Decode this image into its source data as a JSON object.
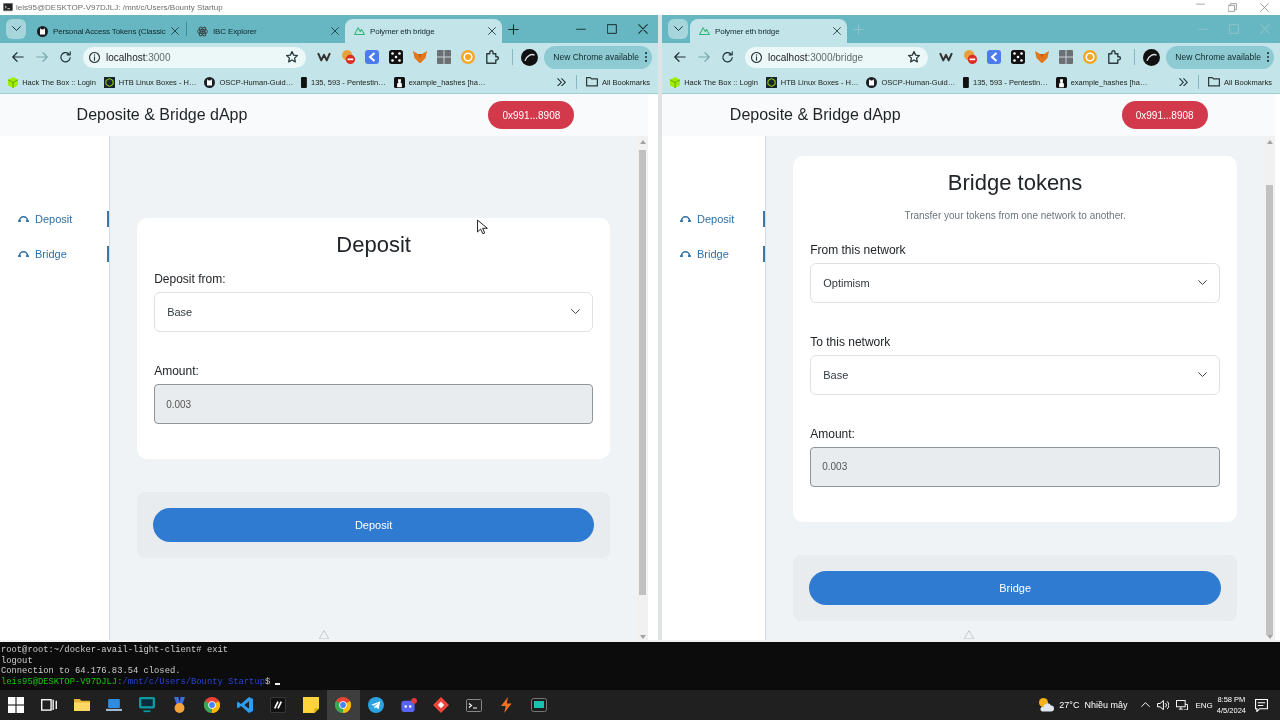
{
  "terminal_window": {
    "title": "leis95@DESKTOP-V97DJLJ: /mnt/c/Users/Bounty Startup"
  },
  "browsers": [
    {
      "focused": true,
      "tabs": [
        {
          "kind": "cat",
          "title": "Personal Access Tokens (Classic",
          "selected": false
        },
        {
          "kind": "atom",
          "title": "IBC Explorer",
          "selected": false
        },
        {
          "kind": "mountain",
          "title": "Polymer eth bridge",
          "selected": true
        }
      ],
      "address": {
        "host": "localhost",
        "path": ":3000"
      },
      "extensions": [
        {
          "kind": "zigzag"
        },
        {
          "kind": "no-entry"
        },
        {
          "kind": "chevron-tile"
        },
        {
          "kind": "dice"
        },
        {
          "kind": "fox"
        },
        {
          "kind": "grid"
        },
        {
          "kind": "coin"
        },
        {
          "kind": "puzzle"
        }
      ],
      "update_button": "New Chrome available",
      "bookmarks": [
        {
          "kind": "cube",
          "label": "Hack The Box :: Login"
        },
        {
          "kind": "box",
          "label": "HTB Linux Boxes - H…"
        },
        {
          "kind": "cat",
          "label": "OSCP-Human-Guid…"
        },
        {
          "kind": "phone",
          "label": "135, 593 - Pentestin…"
        },
        {
          "kind": "figure",
          "label": "example_hashes [ha…"
        }
      ],
      "all_bookmarks": "All Bookmarks",
      "page": {
        "app_title": "Deposite & Bridge dApp",
        "wallet_button": "0x991...8908",
        "nav": [
          {
            "label": "Deposit"
          },
          {
            "label": "Bridge"
          }
        ],
        "card": {
          "title": "Deposit",
          "fields": [
            {
              "kind": "select",
              "label": "Deposit from:",
              "value": "Base"
            },
            {
              "kind": "input",
              "label": "Amount:",
              "value": "0.003"
            }
          ]
        },
        "action_button": "Deposit"
      }
    },
    {
      "focused": false,
      "tabs": [
        {
          "kind": "mountain",
          "title": "Polymer eth bridge",
          "selected": true
        }
      ],
      "address": {
        "host": "localhost",
        "path": ":3000/bridge"
      },
      "extensions": [
        {
          "kind": "zigzag"
        },
        {
          "kind": "no-entry"
        },
        {
          "kind": "chevron-tile"
        },
        {
          "kind": "dice"
        },
        {
          "kind": "fox"
        },
        {
          "kind": "grid"
        },
        {
          "kind": "coin"
        },
        {
          "kind": "puzzle"
        }
      ],
      "update_button": "New Chrome available",
      "bookmarks": [
        {
          "kind": "cube",
          "label": "Hack The Box :: Login"
        },
        {
          "kind": "box",
          "label": "HTB Linux Boxes - H…"
        },
        {
          "kind": "cat",
          "label": "OSCP-Human-Guid…"
        },
        {
          "kind": "phone",
          "label": "135, 593 - Pentestin…"
        },
        {
          "kind": "figure",
          "label": "example_hashes [ha…"
        }
      ],
      "all_bookmarks": "All Bookmarks",
      "page": {
        "app_title": "Deposite & Bridge dApp",
        "wallet_button": "0x991...8908",
        "nav": [
          {
            "label": "Deposit"
          },
          {
            "label": "Bridge"
          }
        ],
        "card": {
          "title": "Bridge tokens",
          "subtitle": "Transfer your tokens from one network to another.",
          "fields": [
            {
              "kind": "select",
              "label": "From this network",
              "value": "Optimism"
            },
            {
              "kind": "select",
              "label": "To this network",
              "value": "Base"
            },
            {
              "kind": "input",
              "label": "Amount:",
              "value": "0.003"
            }
          ]
        },
        "action_button": "Bridge"
      }
    }
  ],
  "terminal_output": {
    "lines": [
      {
        "kind": "text",
        "text": "root@root:~/docker-avail-light-client# exit"
      },
      {
        "kind": "text",
        "text": "logout"
      },
      {
        "kind": "text",
        "text": "Connection to 64.176.83.54 closed."
      },
      {
        "kind": "prompt",
        "user": "leis95@DESKTOP-V97DJLJ:",
        "path": "/mnt/c/Users/Bounty Startup",
        "symbol": "$"
      }
    ]
  },
  "taskbar": {
    "apps": [
      {
        "kind": "start",
        "active": false
      },
      {
        "kind": "task-view",
        "active": false
      },
      {
        "kind": "folder",
        "active": false
      },
      {
        "kind": "laptop",
        "active": false
      },
      {
        "kind": "monitor",
        "active": false
      },
      {
        "kind": "medal",
        "active": false
      },
      {
        "kind": "segmented-circle",
        "active": false
      },
      {
        "kind": "ribbon",
        "active": false
      },
      {
        "kind": "slashes",
        "active": false
      },
      {
        "kind": "sticky-note",
        "active": false
      },
      {
        "kind": "segmented-circle",
        "active": true
      },
      {
        "kind": "paper-plane",
        "active": false
      },
      {
        "kind": "controller",
        "active": false
      },
      {
        "kind": "diamond",
        "active": false
      },
      {
        "kind": "terminal",
        "active": false
      },
      {
        "kind": "bolt",
        "active": false
      },
      {
        "kind": "screen",
        "active": false
      }
    ],
    "weather": {
      "temperature": "27°C",
      "condition": "Nhiều mây"
    },
    "language": "ENG",
    "time": "8:58 PM",
    "date": "4/5/2024"
  }
}
